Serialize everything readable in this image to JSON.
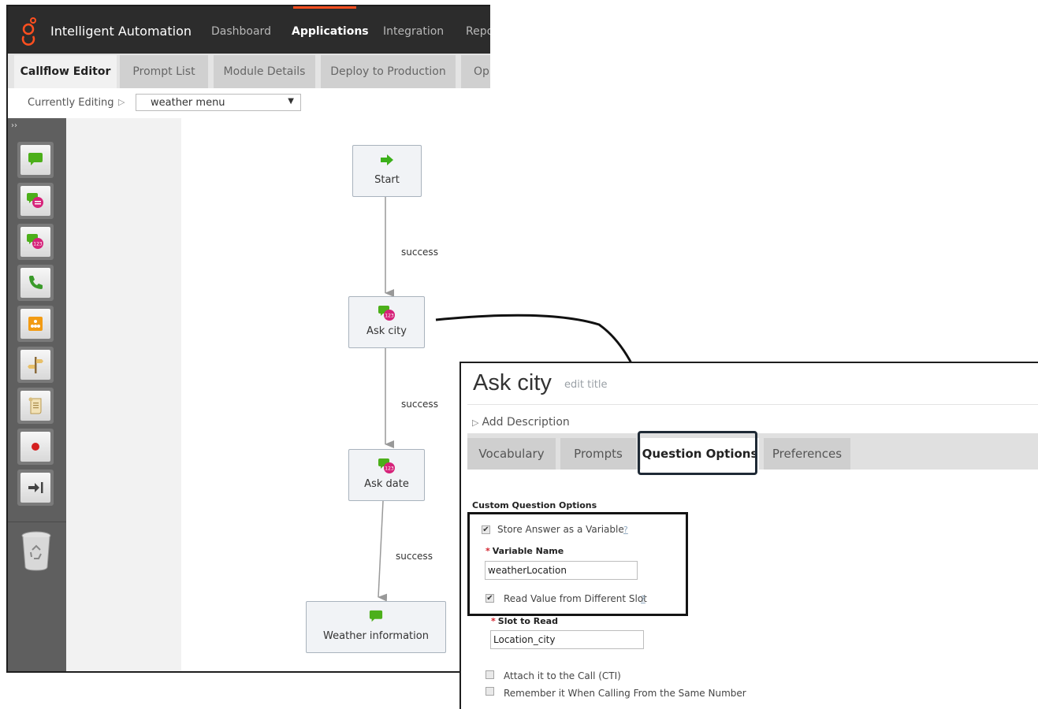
{
  "header": {
    "app_title": "Intelligent Automation",
    "nav": [
      "Dashboard",
      "Applications",
      "Integration",
      "Repo"
    ],
    "active_nav": "Applications",
    "accent_color": "#ff4f1f"
  },
  "tabs": [
    "Callflow Editor",
    "Prompt List",
    "Module Details",
    "Deploy to Production",
    "Op"
  ],
  "active_tab": "Callflow Editor",
  "editing": {
    "label": "Currently Editing",
    "caret": "▷",
    "selected_module": "weather menu"
  },
  "toolbox": {
    "expand_glyph": "››",
    "tools": [
      "message-icon",
      "question-icon",
      "numeric-question-icon",
      "phone-transfer-icon",
      "menu-icon",
      "signpost-icon",
      "script-icon",
      "record-icon",
      "go-to-icon"
    ],
    "trash": "recycle-bin-icon"
  },
  "callflow": {
    "nodes": [
      {
        "label": "Start",
        "icon": "arrow-right-icon"
      },
      {
        "label": "Ask city",
        "icon": "numeric-question-icon"
      },
      {
        "label": "Ask date",
        "icon": "numeric-question-icon"
      },
      {
        "label": "Weather information",
        "icon": "message-icon"
      }
    ],
    "edges": [
      "success",
      "success",
      "success"
    ]
  },
  "panel": {
    "title": "Ask city",
    "edit_title": "edit title",
    "add_description": "Add Description",
    "add_description_caret": "▷",
    "tabs": [
      "Vocabulary",
      "Prompts",
      "Question Options",
      "Preferences"
    ],
    "active_tab": "Question Options",
    "section_heading": "Custom Question Options",
    "help_glyph": "?",
    "required_marker": "*",
    "options": {
      "store_answer": {
        "label": "Store Answer as a Variable",
        "checked": true
      },
      "variable_name": {
        "label": "Variable Name",
        "value": "weatherLocation"
      },
      "read_different_slot": {
        "label": "Read Value from Different Slot",
        "checked": true
      },
      "slot_to_read": {
        "label": "Slot to Read",
        "value": "Location_city"
      },
      "attach_to_call": {
        "label": "Attach it to the Call (CTI)",
        "checked": false
      },
      "remember_number": {
        "label": "Remember it When Calling From the Same Number",
        "checked": false
      }
    }
  }
}
